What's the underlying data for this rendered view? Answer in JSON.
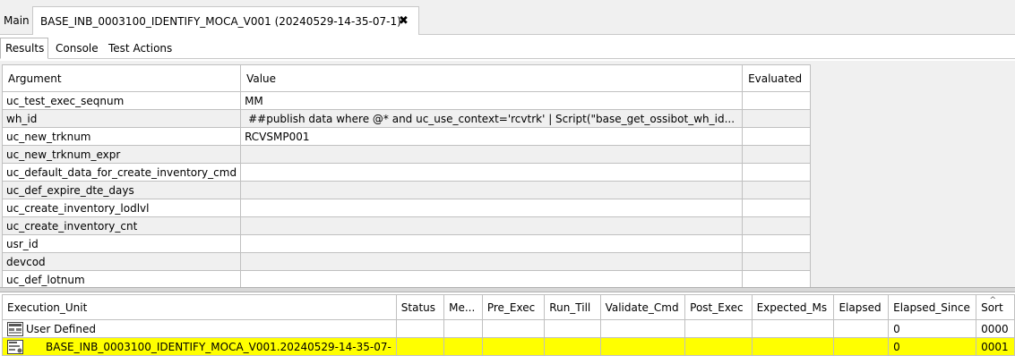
{
  "top_tabs": {
    "main_label": "Main",
    "active_label": "BASE_INB_0003100_IDENTIFY_MOCA_V001 (20240529-14-35-07-1)",
    "close_glyph": "✖"
  },
  "sub_tabs": {
    "results": "Results",
    "console": "Console",
    "test_actions": "Test Actions"
  },
  "arguments": {
    "headers": {
      "argument": "Argument",
      "value": "Value",
      "evaluated": "Evaluated"
    },
    "rows": [
      {
        "argument": "uc_test_exec_seqnum",
        "value": "MM",
        "evaluated": ""
      },
      {
        "argument": "wh_id",
        "value": "##publish data where @* and uc_use_context='rcvtrk' | Script(\"base_get_ossibot_wh_id...",
        "evaluated": ""
      },
      {
        "argument": "uc_new_trknum",
        "value": "RCVSMP001",
        "evaluated": ""
      },
      {
        "argument": "uc_new_trknum_expr",
        "value": "",
        "evaluated": ""
      },
      {
        "argument": "uc_default_data_for_create_inventory_cmd",
        "value": "",
        "evaluated": ""
      },
      {
        "argument": "uc_def_expire_dte_days",
        "value": "",
        "evaluated": ""
      },
      {
        "argument": "uc_create_inventory_lodlvl",
        "value": "",
        "evaluated": ""
      },
      {
        "argument": "uc_create_inventory_cnt",
        "value": "",
        "evaluated": ""
      },
      {
        "argument": "usr_id",
        "value": "",
        "evaluated": ""
      },
      {
        "argument": "devcod",
        "value": "",
        "evaluated": ""
      },
      {
        "argument": "uc_def_lotnum",
        "value": "",
        "evaluated": ""
      }
    ]
  },
  "execution": {
    "headers": {
      "unit": "Execution_Unit",
      "status": "Status",
      "me": "Me...",
      "pre_exec": "Pre_Exec",
      "run_till": "Run_Till",
      "validate_cmd": "Validate_Cmd",
      "post_exec": "Post_Exec",
      "expected_ms": "Expected_Ms",
      "elapsed": "Elapsed",
      "elapsed_since": "Elapsed_Since",
      "sort": "Sort"
    },
    "rows": [
      {
        "unit": "User Defined",
        "elapsed_since": "0",
        "sort": "0000"
      },
      {
        "unit": "BASE_INB_0003100_IDENTIFY_MOCA_V001.20240529-14-35-07-",
        "elapsed_since": "0",
        "sort": "0001"
      }
    ]
  },
  "colors": {
    "highlight": "#ffff00",
    "panel_bg": "#f0f0f0"
  }
}
